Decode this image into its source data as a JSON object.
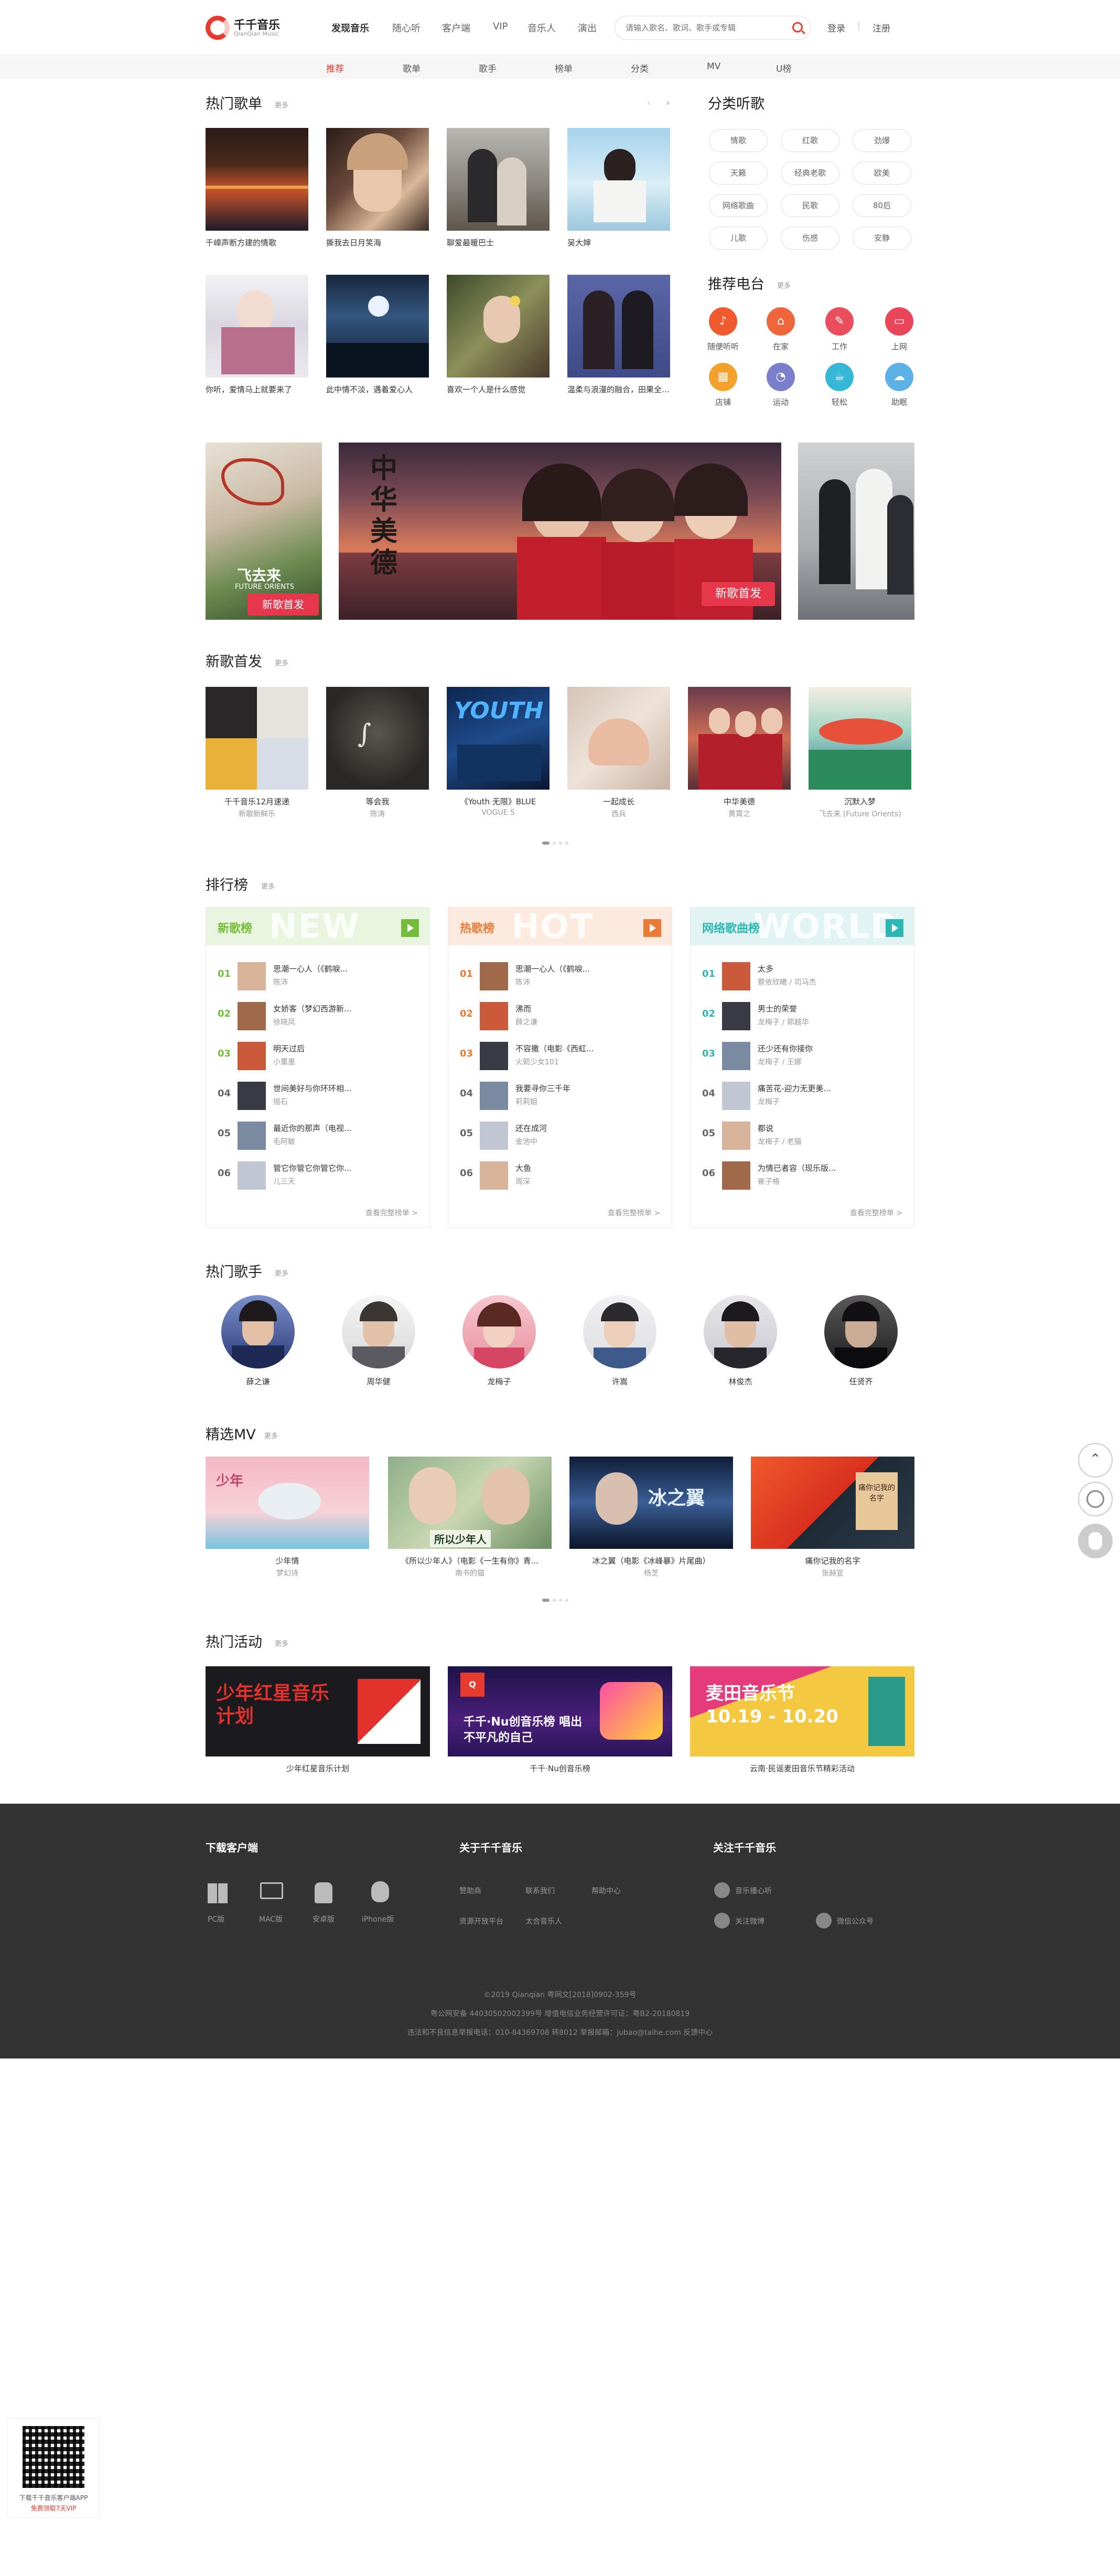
{
  "app": {
    "title": "千千音乐",
    "subtitle": "QianQian Music"
  },
  "nav": [
    "发现音乐",
    "随心听",
    "客户端",
    "VIP",
    "音乐人",
    "演出"
  ],
  "search": {
    "placeholder": "请输入歌名、歌词、歌手或专辑"
  },
  "auth": {
    "login": "登录",
    "sep": "|",
    "register": "注册"
  },
  "subnav": [
    "推荐",
    "歌单",
    "歌手",
    "榜单",
    "分类",
    "MV",
    "U榜"
  ],
  "more": "更多",
  "hot_playlists": {
    "title": "热门歌单",
    "items": [
      "千嶂声断方建的情歌",
      "撕我去日月笑海",
      "聊爱最暖巴士",
      "吴大婶",
      "你听，爱情马上就要来了",
      "此中情不淡，遇着爱心人",
      "喜欢一个人是什么感觉",
      "温柔与浪漫的融合，田果全是精选"
    ]
  },
  "categories": {
    "title": "分类听歌",
    "items": [
      "情歌",
      "红歌",
      "劲爆",
      "天籁",
      "经典老歌",
      "欧美",
      "网络歌曲",
      "民歌",
      "80后",
      "儿歌",
      "伤感",
      "安静"
    ]
  },
  "radio": {
    "title": "推荐电台",
    "items": [
      {
        "label": "随便听听",
        "icon": "music-note-icon",
        "color": "#ef5a2e"
      },
      {
        "label": "在家",
        "icon": "home-icon",
        "color": "#f0663c"
      },
      {
        "label": "工作",
        "icon": "briefcase-icon",
        "color": "#ea4d5c"
      },
      {
        "label": "上网",
        "icon": "monitor-icon",
        "color": "#e94759"
      },
      {
        "label": "店铺",
        "icon": "shop-icon",
        "color": "#f3a02c"
      },
      {
        "label": "运动",
        "icon": "shoe-icon",
        "color": "#7b7ecb"
      },
      {
        "label": "轻松",
        "icon": "couch-icon",
        "color": "#37b7d8"
      },
      {
        "label": "助眠",
        "icon": "cloud-icon",
        "color": "#5cb1e6"
      }
    ]
  },
  "banner": {
    "tag": "新歌首发",
    "left_text": "飞去来",
    "left_sub": "FUTURE ORIENTS",
    "main_text": "中华美德"
  },
  "new_songs": {
    "title": "新歌首发",
    "items": [
      {
        "name": "千千音乐12月速递",
        "artist": "新歌新鲜乐"
      },
      {
        "name": "等会我",
        "artist": "陈涛"
      },
      {
        "name": "《Youth 无限》BLUE",
        "artist": "VOGUE 5"
      },
      {
        "name": "一起成长",
        "artist": "西兵"
      },
      {
        "name": "中华美德",
        "artist": "黄霄之"
      },
      {
        "name": "沉默入梦",
        "artist": "飞去来 (Future Orients)"
      }
    ]
  },
  "charts": {
    "title": "排行榜",
    "all": "查看完整榜单 >",
    "boards": [
      {
        "name": "新歌榜",
        "bg": "NEW",
        "color": "#73bd3b",
        "head": "#eaf5df",
        "songs": [
          {
            "n": "01",
            "s": "思潮一心人（《鹤唳...",
            "a": "陈沛"
          },
          {
            "n": "02",
            "s": "女娇客（梦幻西游新...",
            "a": "徐晓凤"
          },
          {
            "n": "03",
            "s": "明天过后",
            "a": "小董墨"
          },
          {
            "n": "04",
            "s": "世间美好与你环环相...",
            "a": "摇石"
          },
          {
            "n": "05",
            "s": "最近你的那声（电视...",
            "a": "毛阿敏"
          },
          {
            "n": "06",
            "s": "管它你管它你管它你...",
            "a": "儿三天"
          }
        ]
      },
      {
        "name": "热歌榜",
        "bg": "HOT",
        "color": "#ea7b36",
        "head": "#fbeadd",
        "songs": [
          {
            "n": "01",
            "s": "思潮一心人（《鹤唳...",
            "a": "陈沛"
          },
          {
            "n": "02",
            "s": "沸而",
            "a": "薛之谦"
          },
          {
            "n": "03",
            "s": "不容撒（电影《西虹...",
            "a": "火箭少女101"
          },
          {
            "n": "04",
            "s": "我要寻你三千年",
            "a": "莉莉姐"
          },
          {
            "n": "05",
            "s": "还在成河",
            "a": "金池中"
          },
          {
            "n": "06",
            "s": "大鱼",
            "a": "周深"
          }
        ]
      },
      {
        "name": "网络歌曲榜",
        "bg": "WORLD",
        "color": "#2cb7b2",
        "head": "#e1f4f3",
        "songs": [
          {
            "n": "01",
            "s": "太多",
            "a": "蔡依欣曦 / 司马杰"
          },
          {
            "n": "02",
            "s": "男士的荣誉",
            "a": "龙梅子 / 郭越华"
          },
          {
            "n": "03",
            "s": "还少还有你接你",
            "a": "龙梅子 / 王娜"
          },
          {
            "n": "04",
            "s": "痛苦花-迎力无更美...",
            "a": "龙梅子"
          },
          {
            "n": "05",
            "s": "都说",
            "a": "龙梅子 / 老猫"
          },
          {
            "n": "06",
            "s": "为情已者容（现乐版...",
            "a": "崔子格"
          }
        ]
      }
    ]
  },
  "singers": {
    "title": "热门歌手",
    "items": [
      "薛之谦",
      "周华健",
      "龙梅子",
      "许嵩",
      "林俊杰",
      "任贤齐"
    ]
  },
  "mv": {
    "title": "精选MV",
    "items": [
      {
        "name": "少年情",
        "artist": "梦幻诗"
      },
      {
        "name": "《所以少年人》（电影《一生有你》青...",
        "artist": "南书的猫"
      },
      {
        "name": "冰之翼（电影《冰峰暴》片尾曲）",
        "artist": "杨芝"
      },
      {
        "name": "痛你记我的名字",
        "artist": "张赫宣"
      }
    ],
    "texts": [
      "所以少年人",
      "冰之翼",
      "痛你记我的名字"
    ]
  },
  "events": {
    "title": "热门活动",
    "items": [
      {
        "name": "少年红星音乐计划",
        "text": "少年红星音乐计划"
      },
      {
        "name": "千千·Nu创音乐榜",
        "text": "千千·Nu创音乐榜 唱出不平凡的自己"
      },
      {
        "name": "云南·民谣麦田音乐节精彩活动",
        "text": "麦田音乐节 10.19 - 10.20"
      }
    ]
  },
  "footer": {
    "download_title": "下载客户端",
    "clients": [
      "PC版",
      "MAC版",
      "安卓版",
      "iPhone版"
    ],
    "about_title": "关于千千音乐",
    "about": [
      "赞助商",
      "联系我们",
      "帮助中心",
      "资源开放平台",
      "太合音乐人"
    ],
    "follow_title": "关注千千音乐",
    "follow": [
      "音乐播心听",
      "关注微博",
      "微信公众号"
    ],
    "copyright": "©2019 Qianqian 粤网文[2018]0902-359号",
    "license": "粤公网安备 44030502002399号 增值电信业务经营许可证：粤B2-20180819",
    "report": "违法和不良信息举报电话：010-84369708 转8012  举报邮箱：jubao@taihe.com  反馈中心"
  },
  "qr": {
    "line1": "下载千千音乐客户端APP",
    "line2": "免费领取7天VIP"
  }
}
